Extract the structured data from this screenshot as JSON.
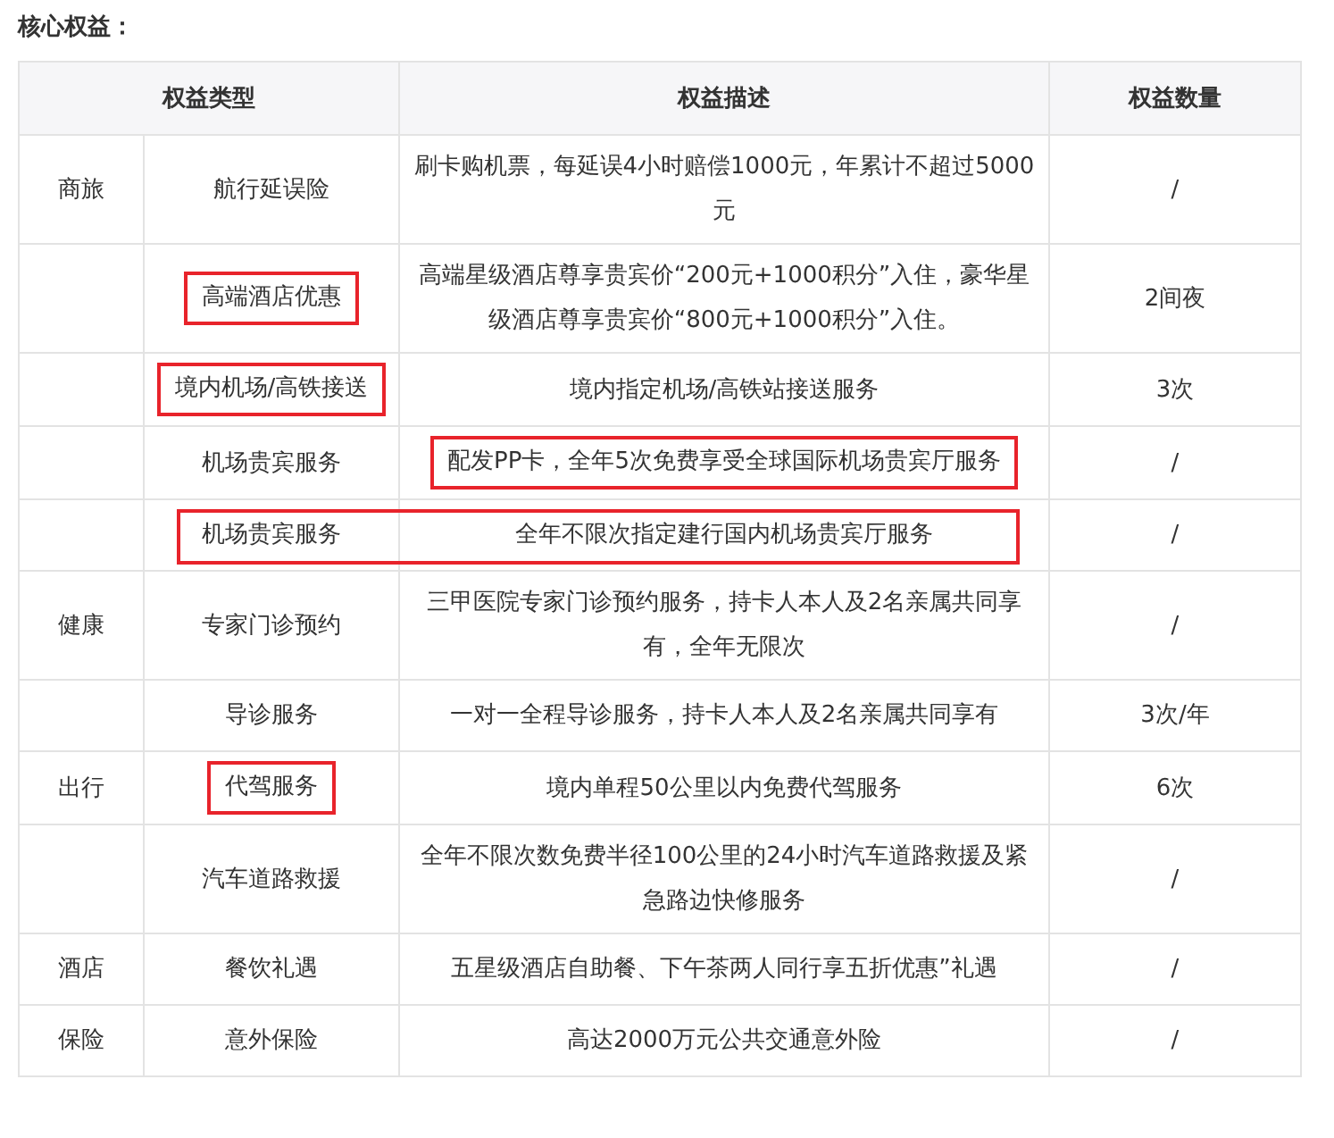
{
  "heading": "核心权益：",
  "table": {
    "columns": [
      "权益类型",
      "权益描述",
      "权益数量"
    ],
    "rows": [
      {
        "category": "商旅",
        "type": "航行延误险",
        "description": "刷卡购机票，每延误4小时赔偿1000元，年累计不超过5000元",
        "quantity": "/",
        "type_marked": false,
        "description_marked": false
      },
      {
        "type": "高端酒店优惠",
        "description": "高端星级酒店尊享贵宾价“200元+1000积分”入住，豪华星级酒店尊享贵宾价“800元+1000积分”入住。",
        "quantity": "2间夜",
        "type_marked": true,
        "description_marked": false
      },
      {
        "type": "境内机场/高铁接送",
        "description": "境内指定机场/高铁站接送服务",
        "quantity": "3次",
        "type_marked": true,
        "description_marked": false
      },
      {
        "type": "机场贵宾服务",
        "description": "配发PP卡，全年5次免费享受全球国际机场贵宾厅服务",
        "quantity": "/",
        "type_marked": false,
        "description_marked": true
      },
      {
        "type": "机场贵宾服务",
        "description": "全年不限次指定建行国内机场贵宾厅服务",
        "quantity": "/",
        "type_marked": true,
        "description_marked": true
      },
      {
        "category": "健康",
        "type": "专家门诊预约",
        "description": "三甲医院专家门诊预约服务，持卡人本人及2名亲属共同享有，全年无限次",
        "quantity": "/",
        "type_marked": false,
        "description_marked": false
      },
      {
        "type": "导诊服务",
        "description": "一对一全程导诊服务，持卡人本人及2名亲属共同享有",
        "quantity": "3次/年",
        "type_marked": false,
        "description_marked": false
      },
      {
        "category": "出行",
        "type": "代驾服务",
        "description": "境内单程50公里以内免费代驾服务",
        "quantity": "6次",
        "type_marked": true,
        "description_marked": false
      },
      {
        "type": "汽车道路救援",
        "description": "全年不限次数免费半径100公里的24小时汽车道路救援及紧急路边快修服务",
        "quantity": "/",
        "type_marked": false,
        "description_marked": false
      },
      {
        "category": "酒店",
        "type": "餐饮礼遇",
        "description": "五星级酒店自助餐、下午茶两人同行享五折优惠”礼遇",
        "quantity": "/",
        "type_marked": false,
        "description_marked": false
      },
      {
        "category": "保险",
        "type": "意外保险",
        "description": "高达2000万元公共交通意外险",
        "quantity": "/",
        "type_marked": false,
        "description_marked": false
      }
    ]
  }
}
